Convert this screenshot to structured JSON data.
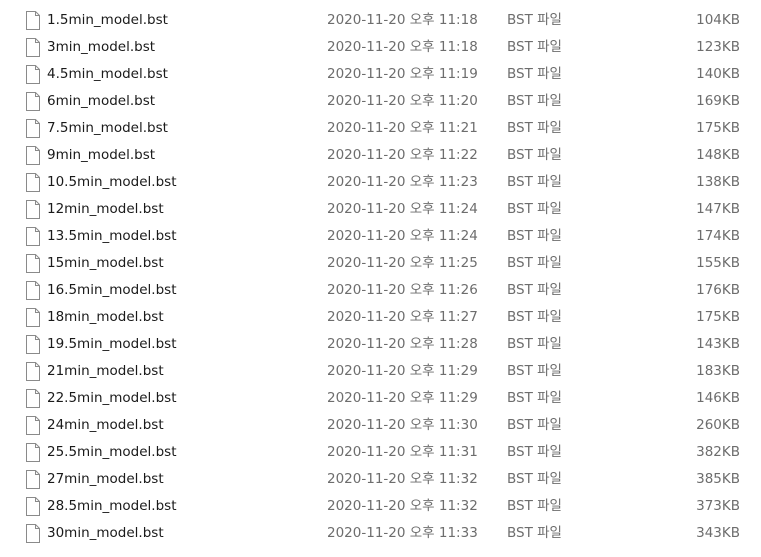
{
  "files": [
    {
      "name": "1.5min_model.bst",
      "date": "2020-11-20 오후 11:18",
      "type": "BST 파일",
      "size": "104KB"
    },
    {
      "name": "3min_model.bst",
      "date": "2020-11-20 오후 11:18",
      "type": "BST 파일",
      "size": "123KB"
    },
    {
      "name": "4.5min_model.bst",
      "date": "2020-11-20 오후 11:19",
      "type": "BST 파일",
      "size": "140KB"
    },
    {
      "name": "6min_model.bst",
      "date": "2020-11-20 오후 11:20",
      "type": "BST 파일",
      "size": "169KB"
    },
    {
      "name": "7.5min_model.bst",
      "date": "2020-11-20 오후 11:21",
      "type": "BST 파일",
      "size": "175KB"
    },
    {
      "name": "9min_model.bst",
      "date": "2020-11-20 오후 11:22",
      "type": "BST 파일",
      "size": "148KB"
    },
    {
      "name": "10.5min_model.bst",
      "date": "2020-11-20 오후 11:23",
      "type": "BST 파일",
      "size": "138KB"
    },
    {
      "name": "12min_model.bst",
      "date": "2020-11-20 오후 11:24",
      "type": "BST 파일",
      "size": "147KB"
    },
    {
      "name": "13.5min_model.bst",
      "date": "2020-11-20 오후 11:24",
      "type": "BST 파일",
      "size": "174KB"
    },
    {
      "name": "15min_model.bst",
      "date": "2020-11-20 오후 11:25",
      "type": "BST 파일",
      "size": "155KB"
    },
    {
      "name": "16.5min_model.bst",
      "date": "2020-11-20 오후 11:26",
      "type": "BST 파일",
      "size": "176KB"
    },
    {
      "name": "18min_model.bst",
      "date": "2020-11-20 오후 11:27",
      "type": "BST 파일",
      "size": "175KB"
    },
    {
      "name": "19.5min_model.bst",
      "date": "2020-11-20 오후 11:28",
      "type": "BST 파일",
      "size": "143KB"
    },
    {
      "name": "21min_model.bst",
      "date": "2020-11-20 오후 11:29",
      "type": "BST 파일",
      "size": "183KB"
    },
    {
      "name": "22.5min_model.bst",
      "date": "2020-11-20 오후 11:29",
      "type": "BST 파일",
      "size": "146KB"
    },
    {
      "name": "24min_model.bst",
      "date": "2020-11-20 오후 11:30",
      "type": "BST 파일",
      "size": "260KB"
    },
    {
      "name": "25.5min_model.bst",
      "date": "2020-11-20 오후 11:31",
      "type": "BST 파일",
      "size": "382KB"
    },
    {
      "name": "27min_model.bst",
      "date": "2020-11-20 오후 11:32",
      "type": "BST 파일",
      "size": "385KB"
    },
    {
      "name": "28.5min_model.bst",
      "date": "2020-11-20 오후 11:32",
      "type": "BST 파일",
      "size": "373KB"
    },
    {
      "name": "30min_model.bst",
      "date": "2020-11-20 오후 11:33",
      "type": "BST 파일",
      "size": "343KB"
    }
  ],
  "icons": {
    "file": "generic-file-icon"
  },
  "colors": {
    "name_text": "#1a1a1a",
    "detail_text": "#6d6d6d",
    "icon_stroke": "#8a8a8a",
    "background": "#ffffff"
  }
}
